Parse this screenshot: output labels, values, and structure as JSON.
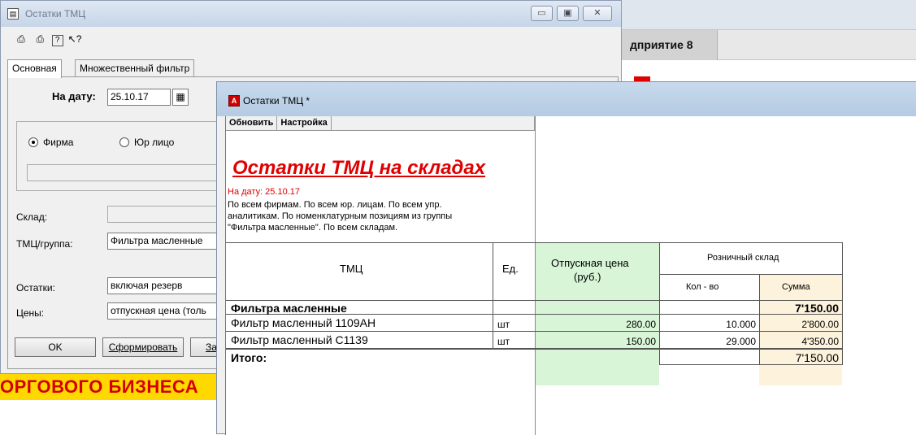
{
  "background": {
    "app_title_fragment": "дприятие 8",
    "banner_text": "ОРГОВОГО БИЗНЕСА"
  },
  "dialog1": {
    "title": "Остатки ТМЦ",
    "title_icon_glyph": "▤",
    "toolbar_icons": [
      "save-settings-icon",
      "restore-settings-icon",
      "help-icon",
      "context-help-icon"
    ],
    "toolbar_glyphs": [
      "⎙",
      "⎙",
      "?",
      "↖?"
    ],
    "tabs": [
      "Основная",
      "Множественный фильтр"
    ],
    "date_label": "На дату:",
    "date_value": "25.10.17",
    "calendar_glyph": "▦",
    "radio_options": [
      "Фирма",
      "Юр лицо"
    ],
    "warehouse_label": "Склад:",
    "warehouse_value": "",
    "item_group_label": "ТМЦ/группа:",
    "item_group_value": "Фильтра масленные",
    "balances_label": "Остатки:",
    "balances_value": "включая резерв",
    "prices_label": "Цены:",
    "prices_value": "отпускная цена (толь",
    "buttons": [
      "OK",
      "Сформировать",
      "За"
    ],
    "window_buttons": [
      "▭",
      "▣",
      "✕"
    ]
  },
  "dialog2": {
    "title": "Остатки ТМЦ  *",
    "title_icon_glyph": "A",
    "toolbar": [
      "Обновить",
      "Настройка"
    ],
    "report_title": "Остатки ТМЦ на складах",
    "report_date": "На дату: 25.10.17",
    "report_filter_lines": [
      "По всем фирмам. По всем юр. лицам. По всем упр.",
      "аналитикам. По номенклатурным позициям из группы",
      "\"Фильтра масленные\". По всем складам."
    ],
    "columns": {
      "item": "ТМЦ",
      "unit": "Ед.",
      "price_line1": "Отпускная цена",
      "price_line2": "(руб.)",
      "warehouse": "Розничный склад",
      "qty": "Кол - во",
      "sum": "Сумма"
    },
    "group": {
      "name": "Фильтра масленные",
      "sum": "7'150.00"
    },
    "rows": [
      {
        "item": "Фильтр масленный 1109АН",
        "unit": "шт",
        "price": "280.00",
        "qty": "10.000",
        "sum": "2'800.00"
      },
      {
        "item": "Фильтр масленный С1139",
        "unit": "шт",
        "price": "150.00",
        "qty": "29.000",
        "sum": "4'350.00"
      }
    ],
    "total": {
      "label": "Итого:",
      "sum": "7'150.00"
    }
  }
}
